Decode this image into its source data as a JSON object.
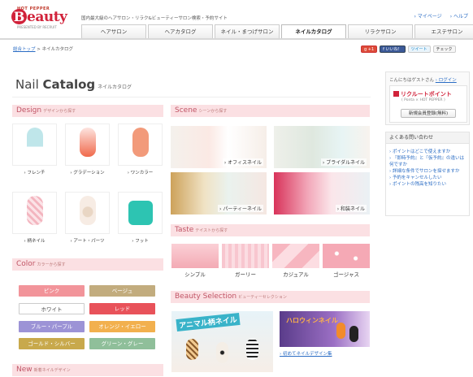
{
  "header": {
    "logo_small": "HOT PEPPER",
    "logo_letter": "B",
    "logo_word": "eauty",
    "logo_sub": "PRESENTED BY RECRUIT",
    "tagline": "国内最大級のヘアサロン・リラク&ビューティーサロン検索・予約サイト",
    "mypage": "› マイページ",
    "help": "› ヘルプ"
  },
  "nav": {
    "tabs": [
      "ヘアサロン",
      "ヘアカタログ",
      "ネイル・まつげサロン",
      "ネイルカタログ",
      "リラクサロン",
      "エステサロン"
    ],
    "active_index": 3
  },
  "breadcrumb": {
    "home": "総合トップ",
    "sep": ">",
    "current": "ネイルカタログ"
  },
  "social": {
    "gplus": "g +1",
    "like": "f いいね！",
    "tweet": "ツイート",
    "check": "チェック"
  },
  "page": {
    "title_plain": "Nail ",
    "title_bold": "Catalog",
    "title_jp": "ネイルカタログ"
  },
  "design": {
    "title": "Design",
    "sub": "デザインから探す",
    "items": [
      "› フレンチ",
      "› グラデーション",
      "› ワンカラー",
      "› 柄ネイル",
      "› アート・パーツ",
      "› フット"
    ]
  },
  "color": {
    "title": "Color",
    "sub": "カラーから探す",
    "items": [
      {
        "label": "ピンク",
        "bg": "#f2949a"
      },
      {
        "label": "ベージュ",
        "bg": "#c2ac7e"
      },
      {
        "label": "ホワイト",
        "bg": "#ffffff"
      },
      {
        "label": "レッド",
        "bg": "#e8525a"
      },
      {
        "label": "ブルー・パープル",
        "bg": "#9c93d6"
      },
      {
        "label": "オレンジ・イエロー",
        "bg": "#f2b04e"
      },
      {
        "label": "ゴールド・シルバー",
        "bg": "#c8a94c"
      },
      {
        "label": "グリーン・グレー",
        "bg": "#8fbf9a"
      }
    ]
  },
  "new_section": {
    "title": "New",
    "sub": "新着ネイルデザイン"
  },
  "scene": {
    "title": "Scene",
    "sub": "シーンから探す",
    "items": [
      "› オフィスネイル",
      "› ブライダルネイル",
      "› パーティーネイル",
      "› 和装ネイル"
    ]
  },
  "taste": {
    "title": "Taste",
    "sub": "テイストから探す",
    "items": [
      "シンプル",
      "ガーリー",
      "カジュアル",
      "ゴージャス"
    ]
  },
  "beauty_selection": {
    "title": "Beauty Selection",
    "sub": "ビューティーセレクション",
    "banner1": "アニマル柄ネイル",
    "banner2": "ハロウィンネイル",
    "link": "› 初めてネイルデザイン集"
  },
  "sidebar": {
    "greeting": "こんにちはゲストさん",
    "login": "› ログイン",
    "points_title": "リクルートポイント",
    "points_sub": "( Ponta × HOT PEPPER )",
    "register": "新規会員登録(無料)",
    "faq_title": "よくある問い合わせ",
    "faq": [
      "› ポイントはどこで使えますか",
      "› 『即時予約』と『仮予約』の違いは何ですか",
      "› 詳細な条件でサロンを探せますか",
      "› 予約をキャンセルしたい",
      "› ポイントの残高を知りたい"
    ]
  }
}
